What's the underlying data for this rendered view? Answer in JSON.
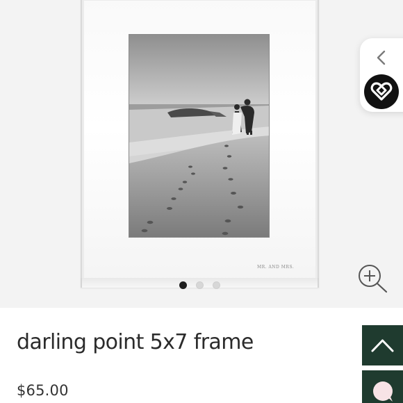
{
  "product": {
    "title": "darling point 5x7 frame",
    "price": "$65.00",
    "frame_engraving": "MR. AND MRS."
  },
  "gallery": {
    "image_count": 3,
    "active_index": 0
  },
  "icons": {
    "zoom": "zoom-in-icon",
    "collapse": "chevron-left-icon",
    "brand": "brand-logo-icon",
    "scroll_top": "chevron-up-icon",
    "chat": "chat-icon"
  },
  "colors": {
    "accent": "#1f3b2f",
    "brand_badge": "#111111",
    "dot_active": "#1e1e1e",
    "dot_inactive": "#d7d7d7"
  }
}
